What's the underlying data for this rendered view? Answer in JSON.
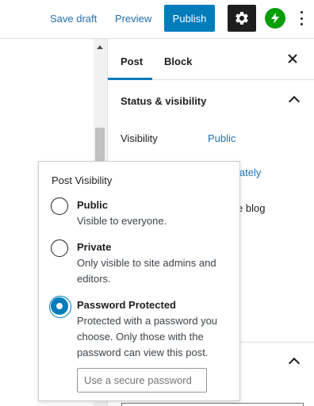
{
  "toolbar": {
    "save_draft": "Save draft",
    "preview": "Preview",
    "publish": "Publish",
    "settings_icon": "gear-icon",
    "jetpack_icon": "jetpack-bolt-icon",
    "more_icon": "more-vertical-icon"
  },
  "sidebar": {
    "tabs": [
      {
        "label": "Post",
        "active": true
      },
      {
        "label": "Block",
        "active": false
      }
    ],
    "close_icon": "close-icon",
    "panel_title": "Status & visibility",
    "visibility_label": "Visibility",
    "visibility_value": "Public",
    "obscured_text_1": "iately",
    "obscured_text_2": "e blog"
  },
  "popover": {
    "title": "Post Visibility",
    "options": [
      {
        "label": "Public",
        "description": "Visible to everyone.",
        "selected": false
      },
      {
        "label": "Private",
        "description": "Only visible to site admins and editors.",
        "selected": false
      },
      {
        "label": "Password Protected",
        "description": "Protected with a password you choose. Only those with the password can view this post.",
        "selected": true
      }
    ],
    "password_placeholder": "Use a secure password",
    "password_value": ""
  },
  "colors": {
    "accent": "#007cba",
    "link": "#2271b1",
    "dark": "#1e1e1e",
    "jetpack": "#069e08"
  }
}
